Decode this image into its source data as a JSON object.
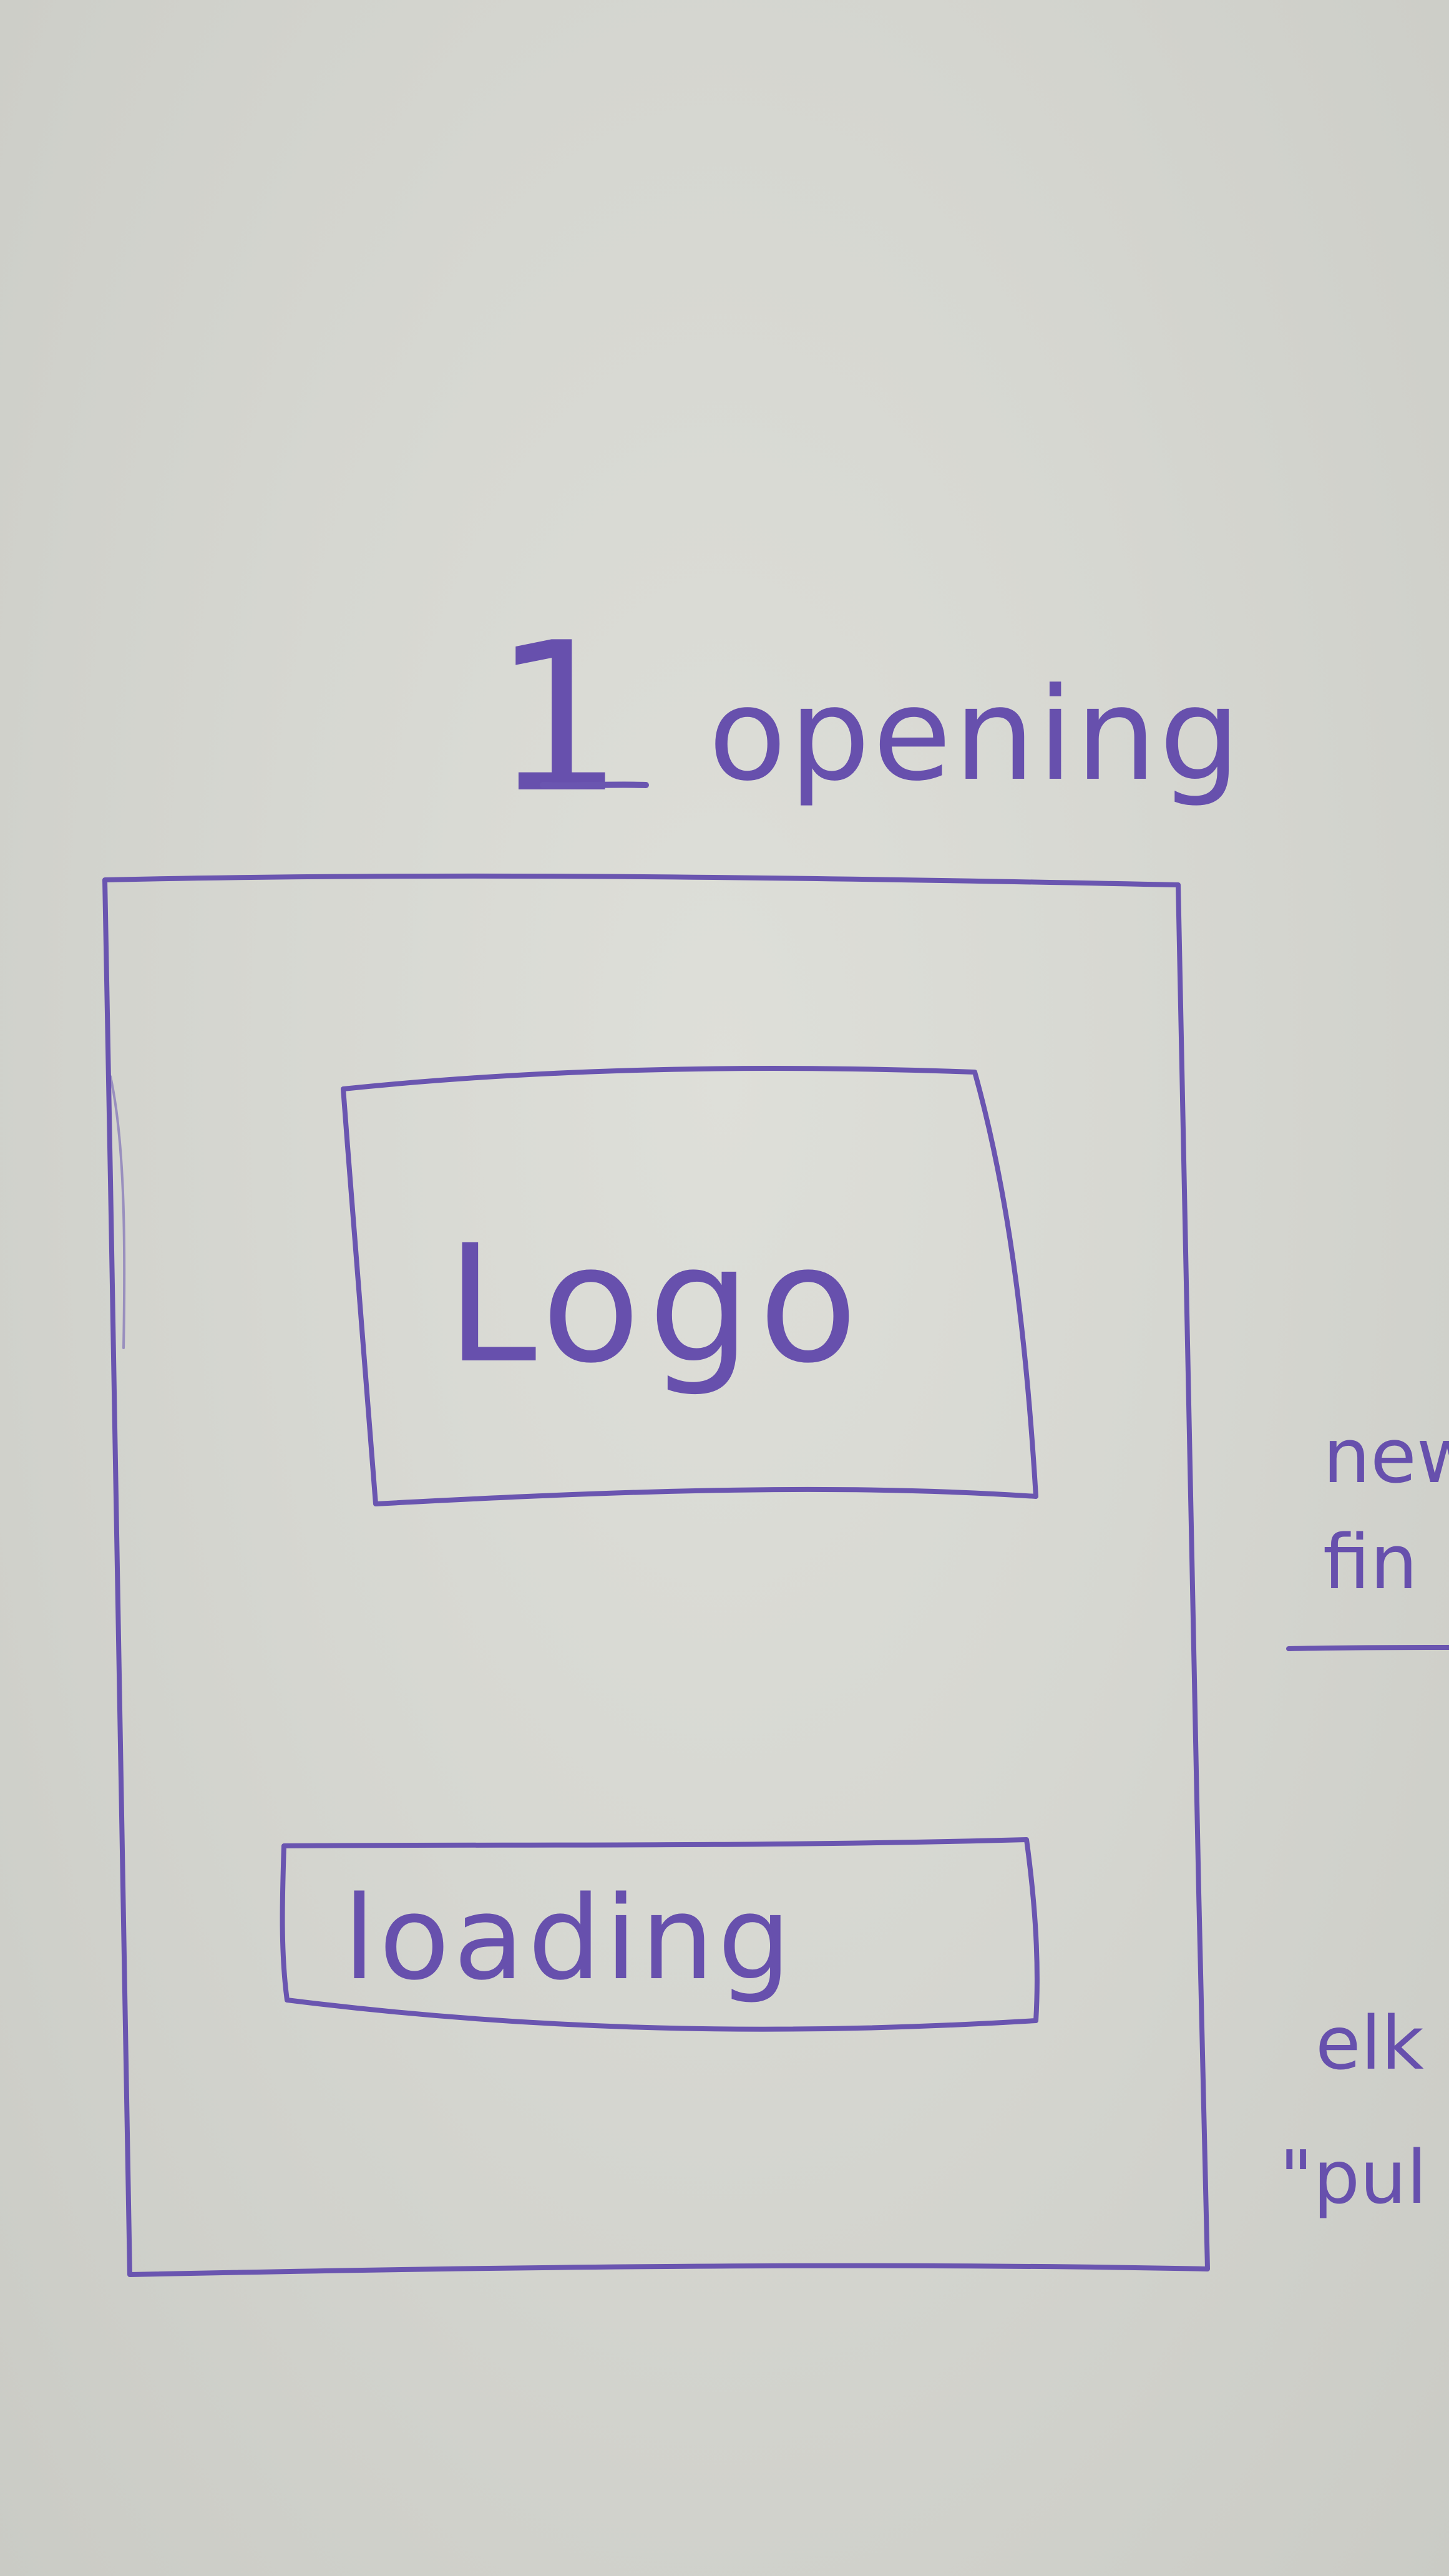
{
  "sketch": {
    "number": "1",
    "heading": "opening",
    "logo_text": "Logo",
    "loading_text": "loading",
    "side_note_line_1": "new",
    "side_note_line_2": "fin",
    "side_note_line_3": "elk",
    "side_note_line_4": "\"pul"
  },
  "colors": {
    "ink": "#6a55b0",
    "paper": "#d6d7d1"
  }
}
